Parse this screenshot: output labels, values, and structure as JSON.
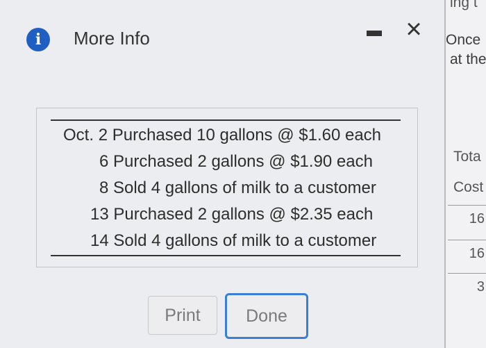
{
  "background_window": {
    "top_fragment": "ing t",
    "line1": "Once",
    "line2": "at the",
    "col_header_1": "Tota",
    "col_header_2": "Cost",
    "cells": [
      "16",
      "16",
      "3"
    ]
  },
  "dialog": {
    "title": "More Info",
    "info_icon": "i",
    "minimize_icon": "minimize-icon",
    "close_icon": "×",
    "transactions": [
      {
        "month": "Oct.",
        "day": "2",
        "description": "Purchased 10 gallons @ $1.60 each"
      },
      {
        "month": "",
        "day": "6",
        "description": "Purchased 2 gallons @ $1.90 each"
      },
      {
        "month": "",
        "day": "8",
        "description": "Sold 4 gallons of milk to a customer"
      },
      {
        "month": "",
        "day": "13",
        "description": "Purchased 2 gallons @ $2.35 each"
      },
      {
        "month": "",
        "day": "14",
        "description": "Sold 4 gallons of milk to a customer"
      }
    ],
    "buttons": {
      "print": "Print",
      "done": "Done"
    },
    "colors": {
      "info_icon": "#1f5fc2",
      "done_border": "#3b7ed6"
    }
  }
}
